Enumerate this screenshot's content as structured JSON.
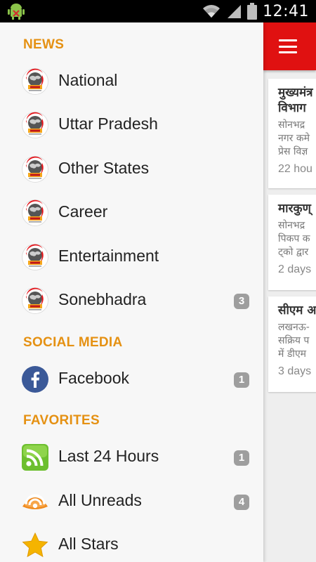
{
  "status_bar": {
    "time": "12:41",
    "icons": [
      "debug-android-icon",
      "wifi-icon",
      "signal-icon",
      "battery-icon"
    ]
  },
  "drawer": {
    "sections": {
      "news": "NEWS",
      "social_media": "SOCIAL MEDIA",
      "favorites": "FAVORITES"
    },
    "news_items": [
      {
        "label": "National",
        "badge": "",
        "icon": "feed-logo-icon"
      },
      {
        "label": "Uttar Pradesh",
        "badge": "",
        "icon": "feed-logo-icon"
      },
      {
        "label": "Other States",
        "badge": "",
        "icon": "feed-logo-icon"
      },
      {
        "label": "Career",
        "badge": "",
        "icon": "feed-logo-icon"
      },
      {
        "label": "Entertainment",
        "badge": "",
        "icon": "feed-logo-icon"
      },
      {
        "label": "Sonebhadra",
        "badge": "3",
        "icon": "feed-logo-icon"
      }
    ],
    "social_items": [
      {
        "label": "Facebook",
        "badge": "1",
        "icon": "facebook-icon"
      }
    ],
    "favorite_items": [
      {
        "label": "Last 24 Hours",
        "badge": "1",
        "icon": "rss-icon"
      },
      {
        "label": "All Unreads",
        "badge": "4",
        "icon": "unread-rss-icon"
      },
      {
        "label": "All Stars",
        "badge": "",
        "icon": "star-icon"
      }
    ]
  },
  "content": {
    "menu_icon": "hamburger-menu-icon",
    "colors": {
      "app_bar": "#e01111",
      "section_header": "#e59113",
      "badge": "#9e9e9e"
    },
    "articles": [
      {
        "title": [
          "मुख्यमंत्र",
          "विभाग"
        ],
        "snippet": [
          "सोनभद्र",
          "नगर कमे",
          "प्रेस विज्ञ"
        ],
        "time": "22 hou"
      },
      {
        "title": [
          "मारकुण्"
        ],
        "snippet": [
          "सोनभद्र",
          "पिकप क",
          "ट्को द्वार"
        ],
        "time": "2 days"
      },
      {
        "title": [
          "सीएम अ"
        ],
        "snippet": [
          "लखनऊ-",
          "सक्रिय प",
          "में डीएम"
        ],
        "time": "3 days"
      }
    ]
  }
}
